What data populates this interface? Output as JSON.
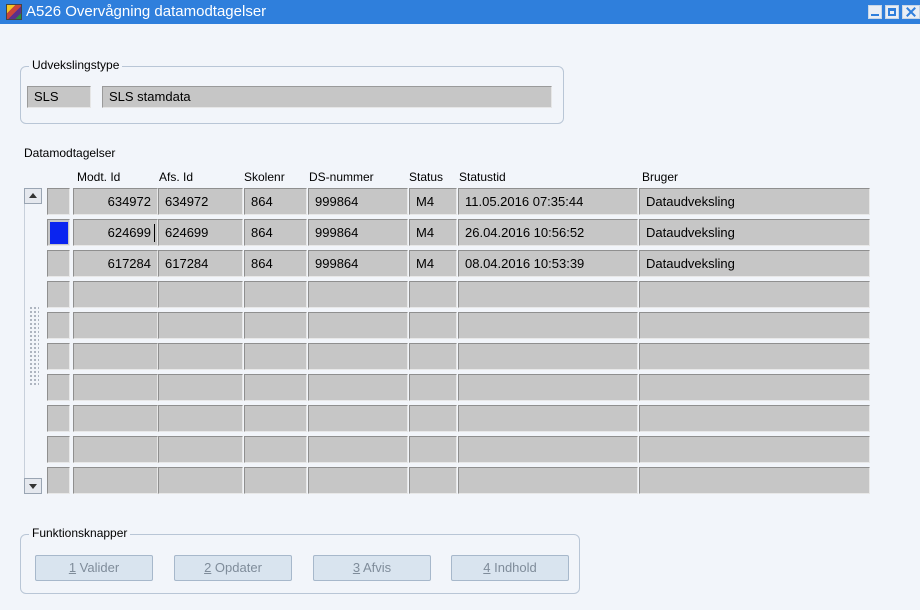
{
  "window": {
    "title": "A526 Overvågning datamodtagelser",
    "app_icon": "oracle-forms-icon"
  },
  "udvekslingstype": {
    "legend": "Udvekslingstype",
    "code": "SLS",
    "description": "SLS stamdata"
  },
  "datamodtagelser": {
    "label": "Datamodtagelser",
    "columns": {
      "modt_id": "Modt. Id",
      "afs_id": "Afs. Id",
      "skolenr": "Skolenr",
      "ds_nummer": "DS-nummer",
      "status": "Status",
      "statustid": "Statustid",
      "bruger": "Bruger"
    },
    "rows": [
      {
        "modt_id": "634972",
        "afs_id": "634972",
        "skolenr": "864",
        "ds_nummer": "999864",
        "status": "M4",
        "statustid": "11.05.2016 07:35:44",
        "bruger": "Dataudveksling",
        "selected": false
      },
      {
        "modt_id": "624699",
        "afs_id": "624699",
        "skolenr": "864",
        "ds_nummer": "999864",
        "status": "M4",
        "statustid": "26.04.2016 10:56:52",
        "bruger": "Dataudveksling",
        "selected": true
      },
      {
        "modt_id": "617284",
        "afs_id": "617284",
        "skolenr": "864",
        "ds_nummer": "999864",
        "status": "M4",
        "statustid": "08.04.2016 10:53:39",
        "bruger": "Dataudveksling",
        "selected": false
      },
      {
        "modt_id": "",
        "afs_id": "",
        "skolenr": "",
        "ds_nummer": "",
        "status": "",
        "statustid": "",
        "bruger": "",
        "selected": false
      },
      {
        "modt_id": "",
        "afs_id": "",
        "skolenr": "",
        "ds_nummer": "",
        "status": "",
        "statustid": "",
        "bruger": "",
        "selected": false
      },
      {
        "modt_id": "",
        "afs_id": "",
        "skolenr": "",
        "ds_nummer": "",
        "status": "",
        "statustid": "",
        "bruger": "",
        "selected": false
      },
      {
        "modt_id": "",
        "afs_id": "",
        "skolenr": "",
        "ds_nummer": "",
        "status": "",
        "statustid": "",
        "bruger": "",
        "selected": false
      },
      {
        "modt_id": "",
        "afs_id": "",
        "skolenr": "",
        "ds_nummer": "",
        "status": "",
        "statustid": "",
        "bruger": "",
        "selected": false
      },
      {
        "modt_id": "",
        "afs_id": "",
        "skolenr": "",
        "ds_nummer": "",
        "status": "",
        "statustid": "",
        "bruger": "",
        "selected": false
      },
      {
        "modt_id": "",
        "afs_id": "",
        "skolenr": "",
        "ds_nummer": "",
        "status": "",
        "statustid": "",
        "bruger": "",
        "selected": false
      }
    ]
  },
  "funktionsknapper": {
    "legend": "Funktionsknapper",
    "buttons": [
      {
        "mnemonic": "1",
        "label": " Valider"
      },
      {
        "mnemonic": "2",
        "label": " Opdater"
      },
      {
        "mnemonic": "3",
        "label": " Afvis"
      },
      {
        "mnemonic": "4",
        "label": " Indhold"
      }
    ]
  },
  "colors": {
    "titlebar": "#2f7fdc",
    "field_bg": "#c6c6c6",
    "selection": "#0a24f0",
    "button_bg": "#d9e4ef",
    "disabled_text": "#7f8c9a"
  }
}
